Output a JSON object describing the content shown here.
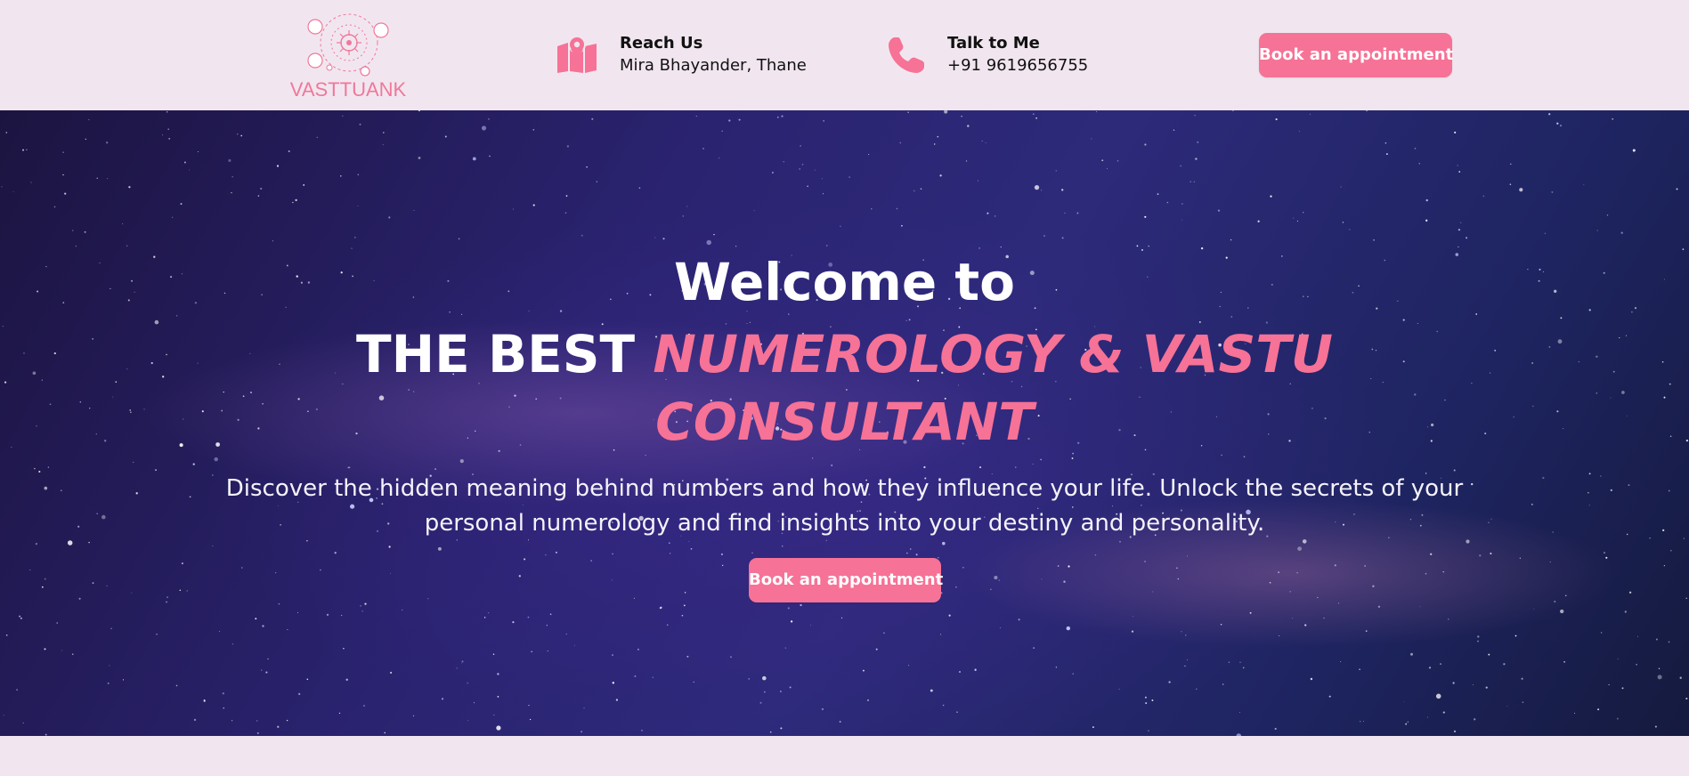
{
  "brand": {
    "name": "VASTTUANK"
  },
  "contacts": [
    {
      "title": "Reach Us",
      "detail": "Mira Bhayander, Thane",
      "icon": "map-icon"
    },
    {
      "title": "Talk to Me",
      "detail": "+91 9619656755",
      "icon": "phone-icon"
    }
  ],
  "header": {
    "cta_label": "Book an appointment"
  },
  "hero": {
    "welcome": "Welcome to",
    "headline_white": "THE BEST",
    "headline_pink_line1": "NUMEROLOGY & VASTU",
    "headline_pink_line2": "CONSULTANT",
    "description": "Discover the hidden meaning behind numbers and how they influence your life. Unlock the secrets of your personal numerology and find insights into your destiny and personality.",
    "cta_label": "Book an appointment"
  },
  "colors": {
    "accent": "#f67296",
    "header_bg": "#f1e6ef",
    "hero_bg": "#2a2370"
  }
}
